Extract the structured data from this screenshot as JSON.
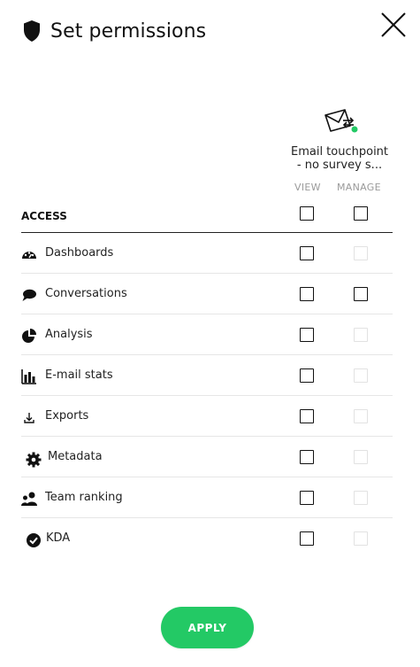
{
  "dialog": {
    "title": "Set permissions",
    "apply_label": "APPLY",
    "accent_color": "#23c965"
  },
  "touchpoint": {
    "name_line1": "Email touchpoint",
    "name_line2": "- no survey s...",
    "icon": "envelope-transfer-icon",
    "status_dot_color": "#23c965"
  },
  "columns": {
    "view": "VIEW",
    "manage": "MANAGE"
  },
  "access": {
    "label": "ACCESS",
    "view_checked": false,
    "manage_checked": false
  },
  "permissions": [
    {
      "label": "Dashboards",
      "icon": "gauge-icon",
      "view_checked": false,
      "manage_enabled": false
    },
    {
      "label": "Conversations",
      "icon": "speech-bubble-icon",
      "view_checked": false,
      "manage_enabled": true
    },
    {
      "label": "Analysis",
      "icon": "pie-chart-icon",
      "view_checked": false,
      "manage_enabled": false
    },
    {
      "label": "E-mail stats",
      "icon": "bar-chart-icon",
      "view_checked": false,
      "manage_enabled": false
    },
    {
      "label": "Exports",
      "icon": "download-icon",
      "view_checked": false,
      "manage_enabled": false
    },
    {
      "label": "Metadata",
      "icon": "gear-icon",
      "view_checked": false,
      "manage_enabled": false
    },
    {
      "label": "Team ranking",
      "icon": "team-icon",
      "view_checked": false,
      "manage_enabled": false
    },
    {
      "label": "KDA",
      "icon": "check-circle-icon",
      "view_checked": false,
      "manage_enabled": false
    }
  ]
}
